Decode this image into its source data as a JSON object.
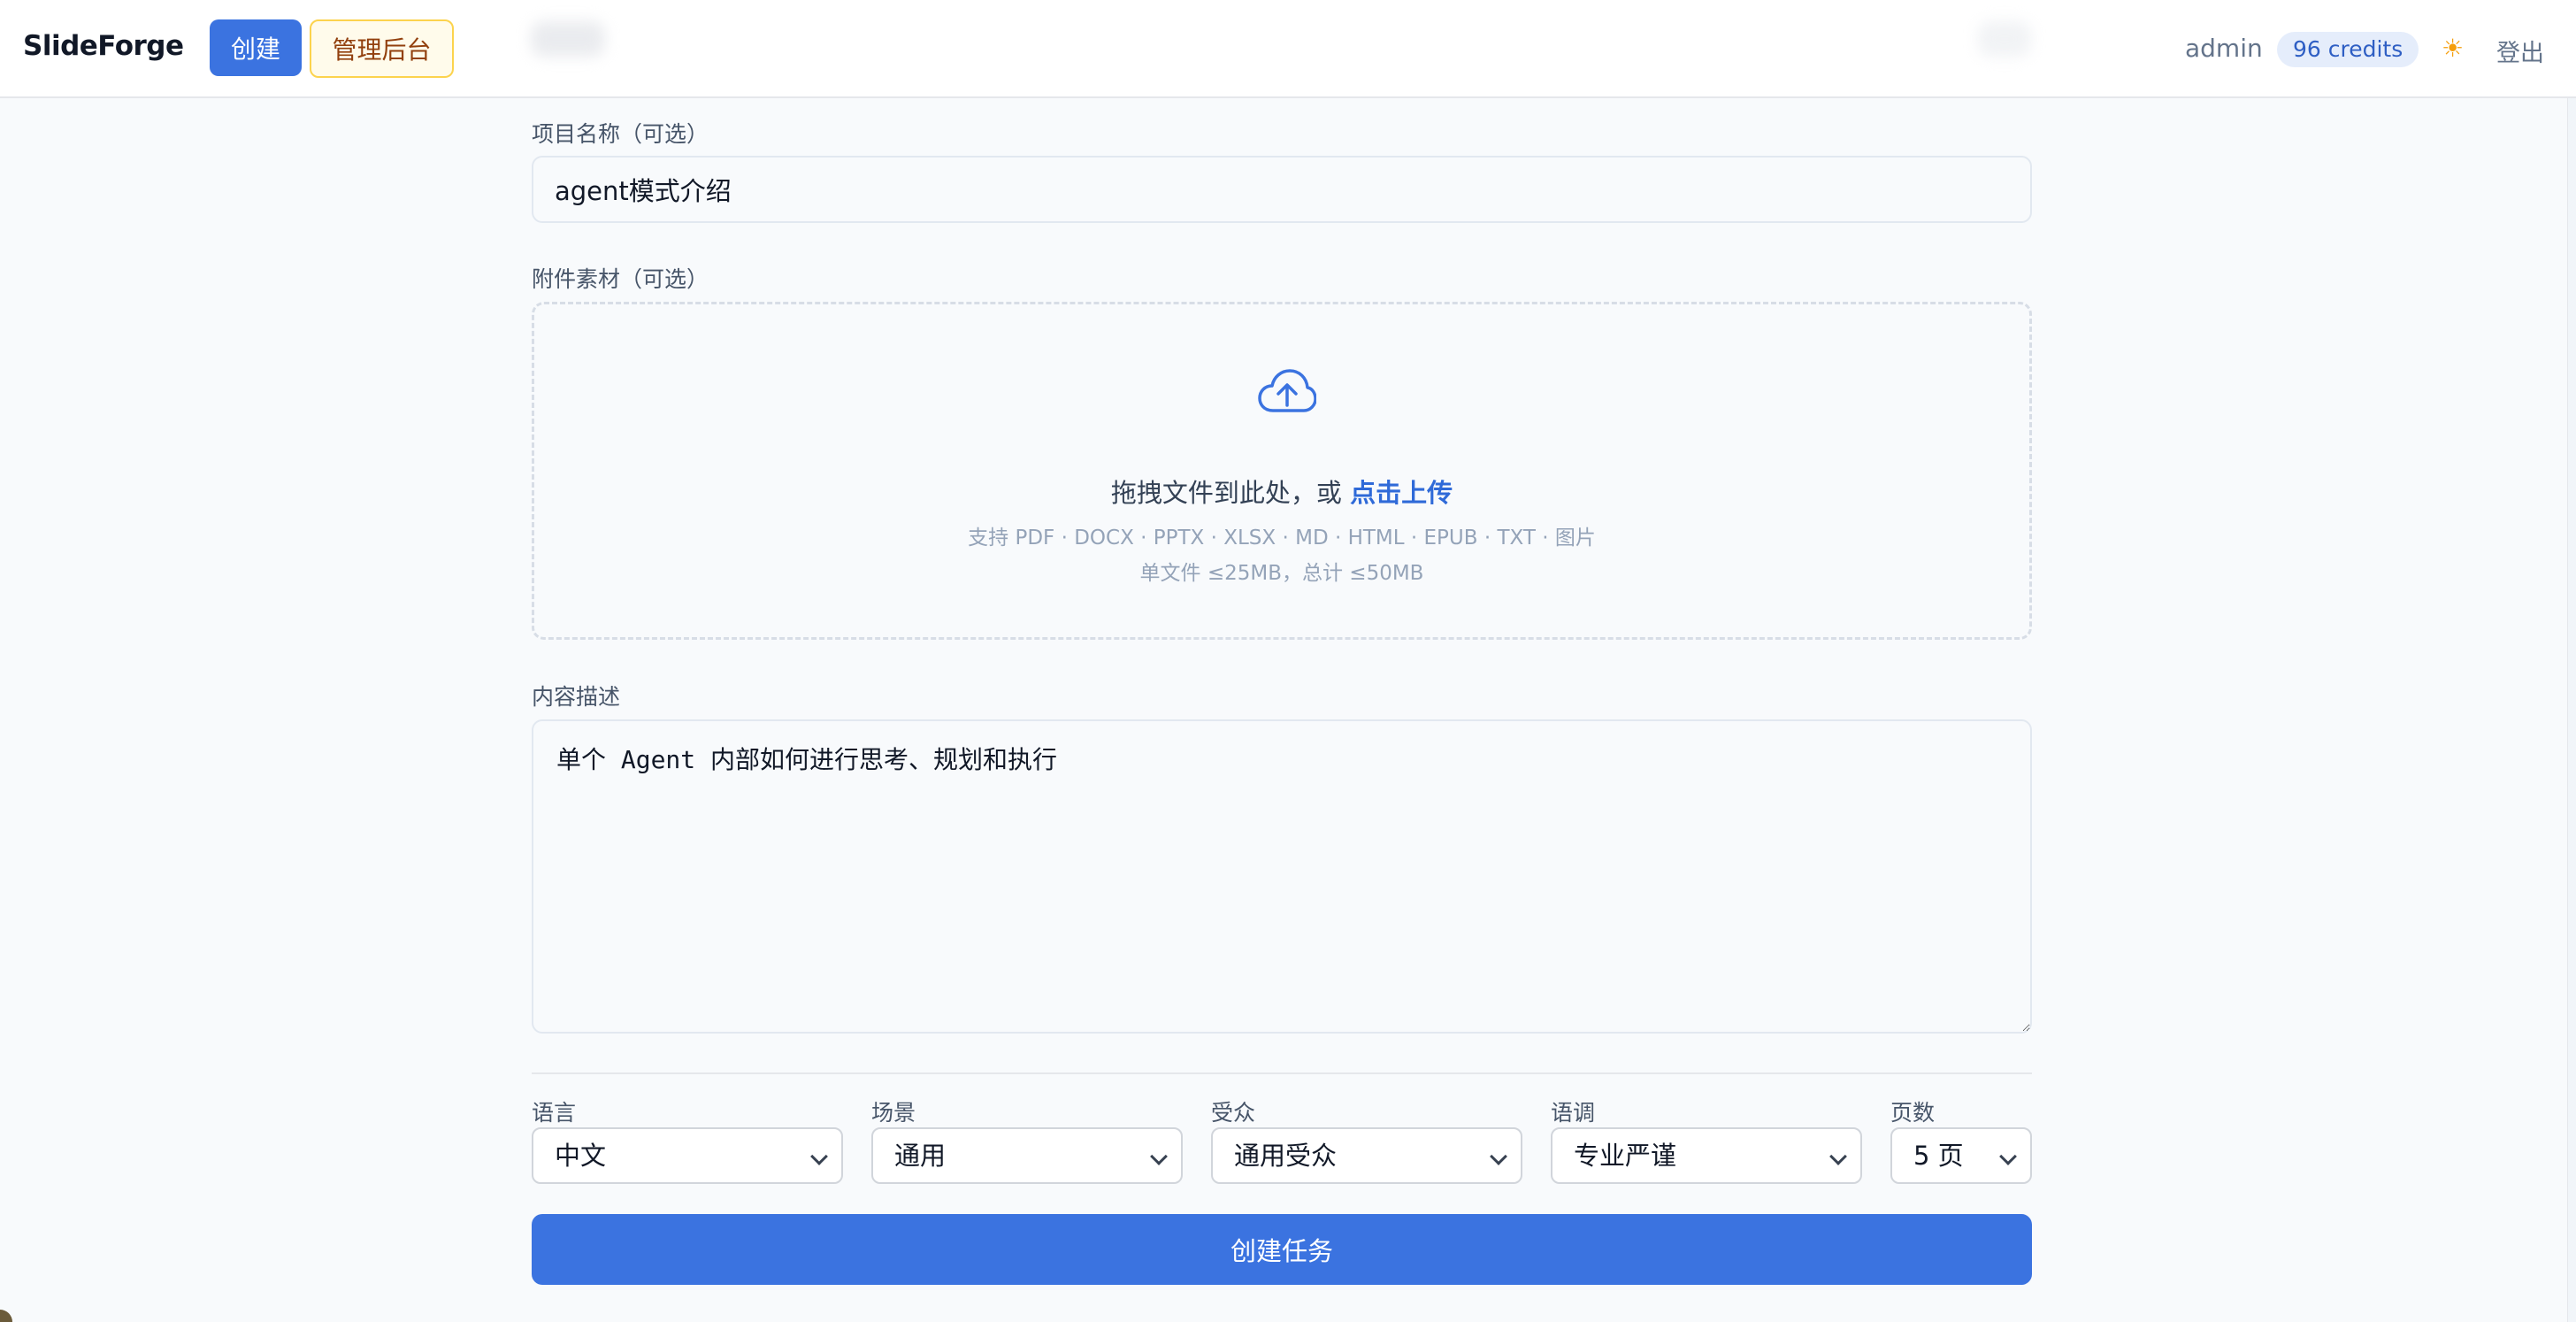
{
  "header": {
    "brand": "SlideForge",
    "create_label": "创建",
    "admin_label": "管理后台",
    "username": "admin",
    "credits": "96 credits",
    "theme_icon": "sun-icon",
    "logout_label": "登出"
  },
  "form": {
    "project_name_label": "项目名称（可选）",
    "project_name_value": "agent模式介绍",
    "attachments_label": "附件素材（可选）",
    "drop_text": "拖拽文件到此处，或",
    "drop_link": "点击上传",
    "supported_types": "支持 PDF · DOCX · PPTX · XLSX · MD · HTML · EPUB · TXT · 图片",
    "size_limit": "单文件 ≤25MB，总计 ≤50MB",
    "upload_icon": "cloud-upload-icon",
    "description_label": "内容描述",
    "description_value": "单个 Agent 内部如何进行思考、规划和执行",
    "options": {
      "language_label": "语言",
      "language_value": "中文",
      "scene_label": "场景",
      "scene_value": "通用",
      "audience_label": "受众",
      "audience_value": "通用受众",
      "tone_label": "语调",
      "tone_value": "专业严谨",
      "pages_label": "页数",
      "pages_value": "5 页"
    },
    "submit_label": "创建任务"
  },
  "colors": {
    "primary": "#3b73e0",
    "admin_bg": "#fffbeb",
    "admin_border": "#fcd34d",
    "credits_bg": "#e5edfb"
  }
}
